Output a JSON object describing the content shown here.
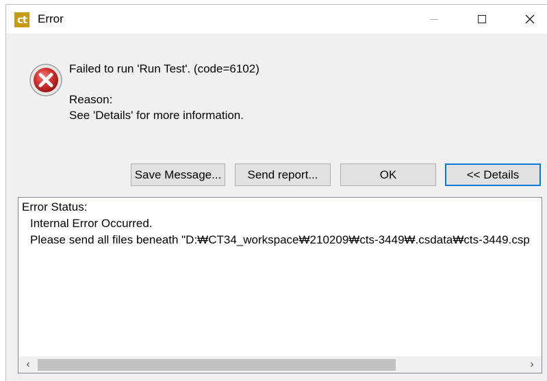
{
  "window": {
    "title": "Error",
    "app_icon_text": "ct"
  },
  "titlebar_controls": {
    "minimize": "minimize-icon",
    "maximize": "maximize-icon",
    "close": "close-icon"
  },
  "message": {
    "icon": "error-icon",
    "headline": "Failed to run 'Run Test'. (code=6102)",
    "reason_label": "Reason:",
    "reason_text": "See 'Details' for more information."
  },
  "buttons": {
    "save_message": "Save Message...",
    "send_report": "Send report...",
    "ok": "OK",
    "details": "<< Details"
  },
  "details": {
    "lines": [
      "Error Status:",
      "Internal Error Occurred.",
      "Please send all files beneath \"D:₩CT34_workspace₩210209₩cts-3449₩.csdata₩cts-3449.csp"
    ],
    "scroll_left": "‹",
    "scroll_right": "›"
  },
  "colors": {
    "accent": "#0078d7",
    "app_icon_bg": "#c79a15",
    "error_red": "#d32f2f"
  }
}
